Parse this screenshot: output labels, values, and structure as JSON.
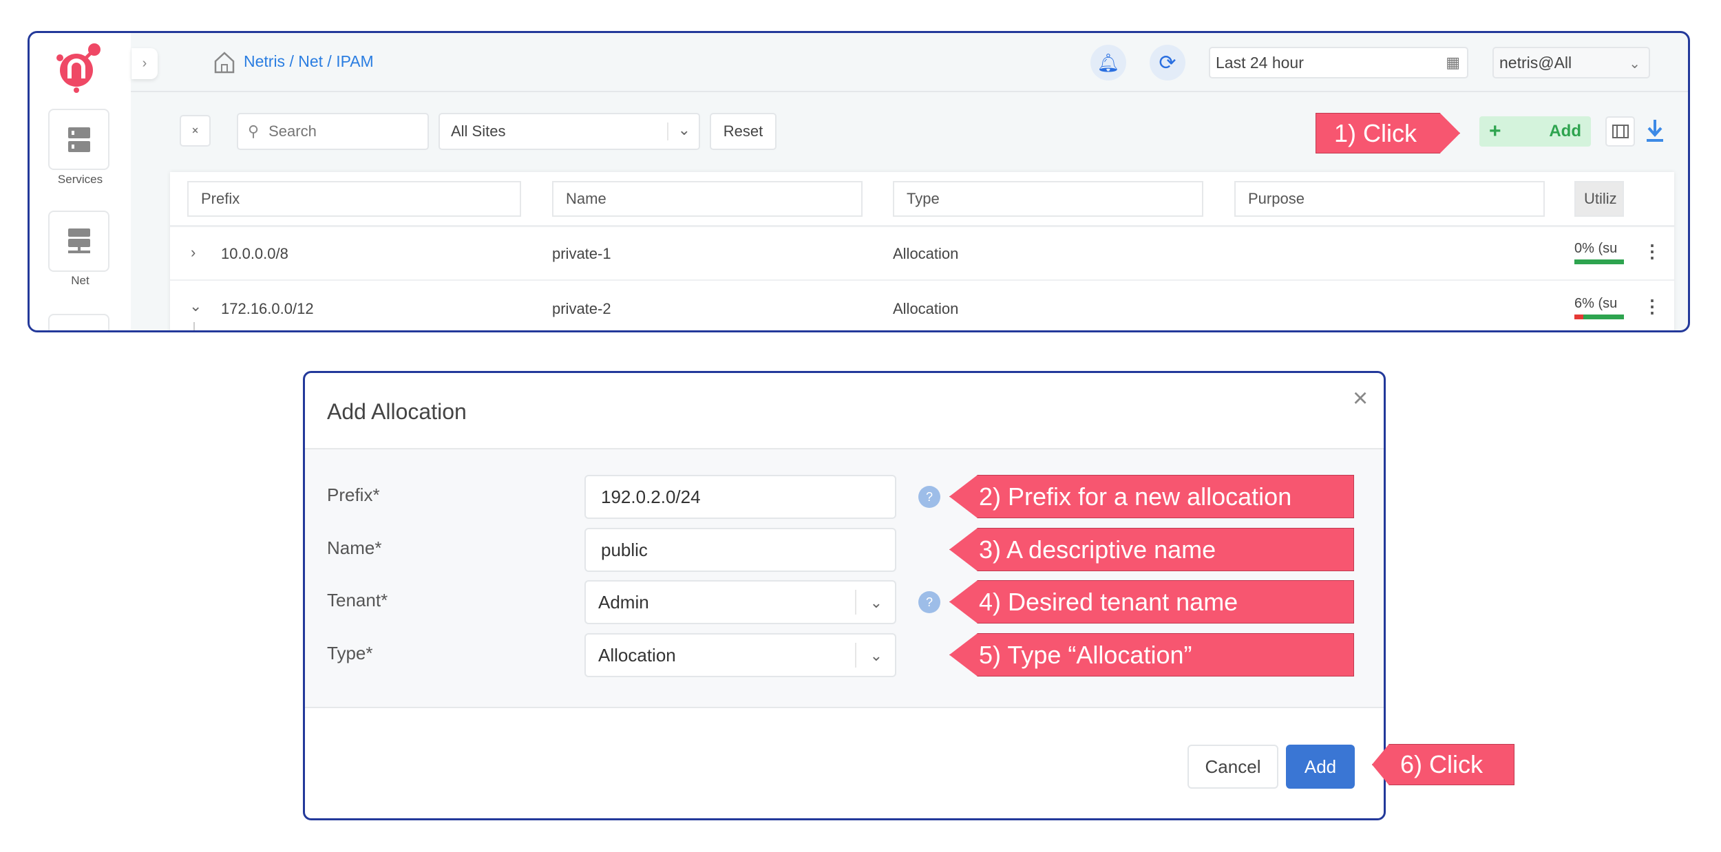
{
  "breadcrumb": "Netris / Net / IPAM",
  "sidebar": {
    "items": [
      {
        "label": "Services",
        "icon": "server-icon"
      },
      {
        "label": "Net",
        "icon": "network-icon"
      }
    ]
  },
  "header": {
    "time_range": "Last 24 hour",
    "tenant_select": "netris@All"
  },
  "toolbar": {
    "search_placeholder": "Search",
    "site_select": "All Sites",
    "reset_label": "Reset",
    "add_label": "Add",
    "add_icon": "+"
  },
  "table": {
    "columns": [
      "Prefix",
      "Name",
      "Type",
      "Purpose",
      "Utiliz"
    ],
    "rows": [
      {
        "prefix": "10.0.0.0/8",
        "name": "private-1",
        "type": "Allocation",
        "purpose": "",
        "utilization": "0% (su",
        "used_fraction": 0.0,
        "expanded": false
      },
      {
        "prefix": "172.16.0.0/12",
        "name": "private-2",
        "type": "Allocation",
        "purpose": "",
        "utilization": "6% (su",
        "used_fraction": 0.06,
        "expanded": true
      }
    ]
  },
  "dialog": {
    "title": "Add Allocation",
    "fields": [
      {
        "label": "Prefix*",
        "value": "192.0.2.0/24"
      },
      {
        "label": "Name*",
        "value": "public"
      },
      {
        "label": "Tenant*",
        "value": "Admin"
      },
      {
        "label": "Type*",
        "value": "Allocation"
      }
    ],
    "cancel_label": "Cancel",
    "add_label": "Add"
  },
  "annotations": {
    "step1": "1) Click",
    "step2": "2) Prefix for a new allocation",
    "step3": "3) A descriptive name",
    "step4": "4) Desired tenant name",
    "step5": "5) Type “Allocation”",
    "step6": "6) Click"
  },
  "colors": {
    "callout": "#f75670",
    "frame": "#23399a",
    "primary": "#3a76d4",
    "add_green": "#2ea44f",
    "util_used": "#e53935",
    "util_free": "#2ea44f"
  }
}
